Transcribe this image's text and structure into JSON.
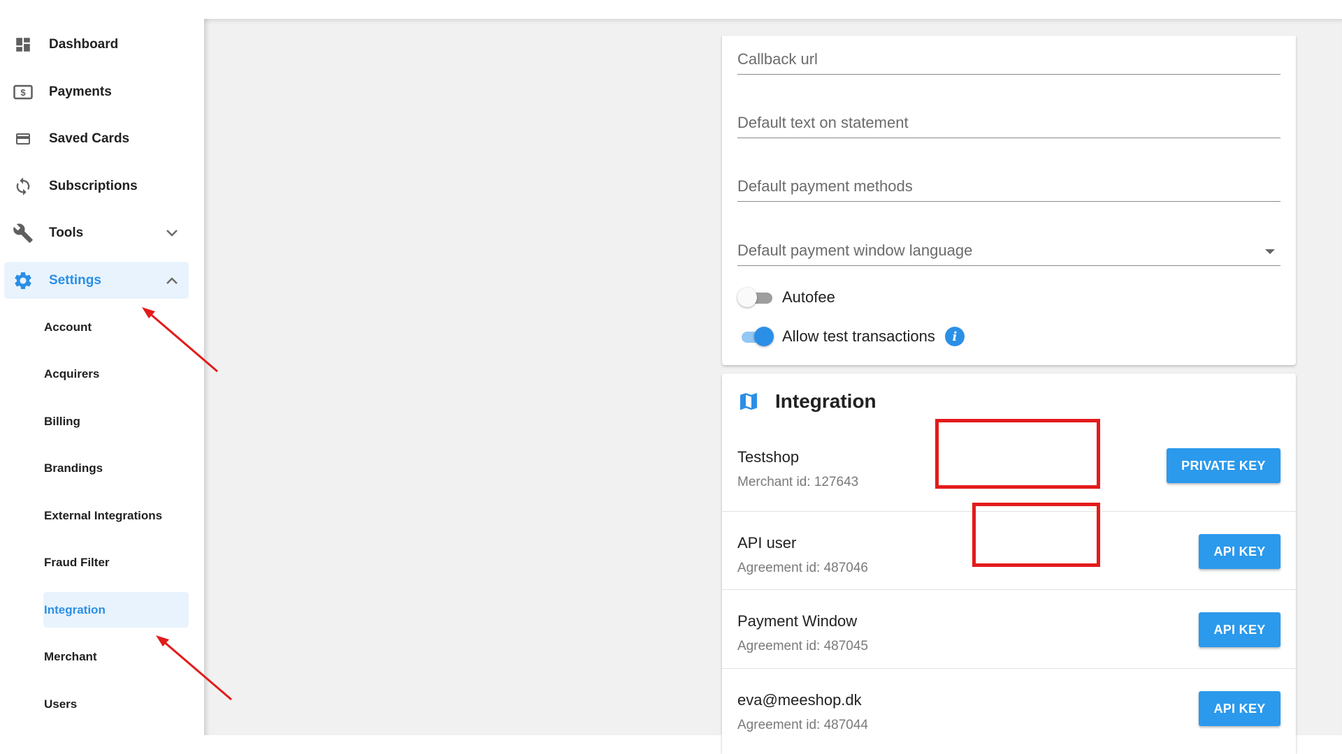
{
  "sidebar": {
    "items": [
      {
        "label": "Dashboard",
        "icon": "dashboard-icon"
      },
      {
        "label": "Payments",
        "icon": "payments-icon"
      },
      {
        "label": "Saved Cards",
        "icon": "credit-card-icon"
      },
      {
        "label": "Subscriptions",
        "icon": "sync-icon"
      },
      {
        "label": "Tools",
        "icon": "wrench-icon"
      },
      {
        "label": "Settings",
        "icon": "gear-icon"
      }
    ],
    "settings_subitems": [
      "Account",
      "Acquirers",
      "Billing",
      "Brandings",
      "External Integrations",
      "Fraud Filter",
      "Integration",
      "Merchant",
      "Users"
    ],
    "active_item": "Settings",
    "active_subitem": "Integration"
  },
  "settings_form": {
    "fields": {
      "callback_url": "Callback url",
      "default_text": "Default text on statement",
      "default_methods": "Default payment methods",
      "default_language": "Default payment window language"
    },
    "toggles": {
      "autofee": {
        "label": "Autofee",
        "on": false
      },
      "test_transactions": {
        "label": "Allow test transactions",
        "on": true
      }
    }
  },
  "integration": {
    "title": "Integration",
    "rows": [
      {
        "title": "Testshop",
        "subtitle": "Merchant id: 127643",
        "button": "PRIVATE KEY"
      },
      {
        "title": "API user",
        "subtitle": "Agreement id: 487046",
        "button": "API KEY"
      },
      {
        "title": "Payment Window",
        "subtitle": "Agreement id: 487045",
        "button": "API KEY"
      },
      {
        "title": "eva@meeshop.dk",
        "subtitle": "Agreement id: 487044",
        "button": "API KEY"
      }
    ]
  },
  "colors": {
    "accent": "#2b8fe6",
    "button": "#2b99ec",
    "annotation": "#e31b1b",
    "active_bg": "#e9f3fd"
  }
}
